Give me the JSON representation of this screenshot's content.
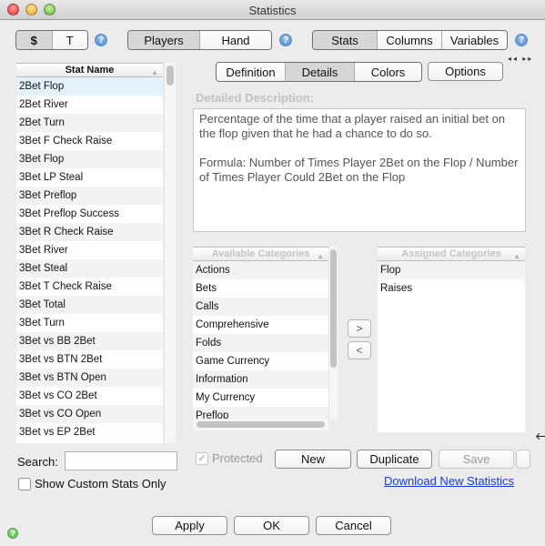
{
  "window": {
    "title": "Statistics"
  },
  "toolbar": {
    "currency_tabs": [
      {
        "label": "$",
        "selected": true
      },
      {
        "label": "T",
        "selected": false
      }
    ],
    "view_tabs": [
      {
        "label": "Players",
        "selected": true
      },
      {
        "label": "Hand",
        "selected": false
      }
    ],
    "section_tabs": [
      {
        "label": "Stats",
        "selected": true
      },
      {
        "label": "Columns",
        "selected": false
      },
      {
        "label": "Variables",
        "selected": false
      }
    ],
    "help_icon": "?"
  },
  "stat_list": {
    "header": "Stat Name",
    "items": [
      "2Bet Flop",
      "2Bet River",
      "2Bet Turn",
      "3Bet F Check Raise",
      "3Bet Flop",
      "3Bet LP Steal",
      "3Bet Preflop",
      "3Bet Preflop Success",
      "3Bet R Check Raise",
      "3Bet River",
      "3Bet Steal",
      "3Bet T Check Raise",
      "3Bet Total",
      "3Bet Turn",
      "3Bet vs BB 2Bet",
      "3Bet vs BTN 2Bet",
      "3Bet vs BTN Open",
      "3Bet vs CO 2Bet",
      "3Bet vs CO Open",
      "3Bet vs EP 2Bet"
    ],
    "selected": "2Bet Flop"
  },
  "detail_tabs": [
    {
      "label": "Definition",
      "selected": false
    },
    {
      "label": "Details",
      "selected": true
    },
    {
      "label": "Colors",
      "selected": false
    }
  ],
  "options_label": "Options",
  "nav_arrows": "◂◂ ▸▸",
  "description": {
    "label": "Detailed Description:",
    "text": "Percentage of the time that a player raised an initial bet on the flop given that he had a chance to do so.\n\nFormula: Number of Times Player 2Bet on the Flop / Number of Times Player Could 2Bet on the Flop"
  },
  "available_categories": {
    "header": "Available Categories",
    "items": [
      "Actions",
      "Bets",
      "Calls",
      "Comprehensive",
      "Folds",
      "Game Currency",
      "Information",
      "My Currency",
      "Preflop"
    ]
  },
  "assigned_categories": {
    "header": "Assigned Categories",
    "items": [
      "Flop",
      "Raises"
    ]
  },
  "move_buttons": {
    "add": ">",
    "remove": "<"
  },
  "search": {
    "label": "Search:",
    "value": "",
    "placeholder": ""
  },
  "show_custom": {
    "label": "Show Custom Stats Only",
    "checked": false
  },
  "protected": {
    "label": "Protected",
    "checked": true
  },
  "action_buttons": {
    "new": "New",
    "duplicate": "Duplicate",
    "save": "Save"
  },
  "download_link": "Download New Statistics",
  "footer_buttons": {
    "apply": "Apply",
    "ok": "OK",
    "cancel": "Cancel"
  }
}
